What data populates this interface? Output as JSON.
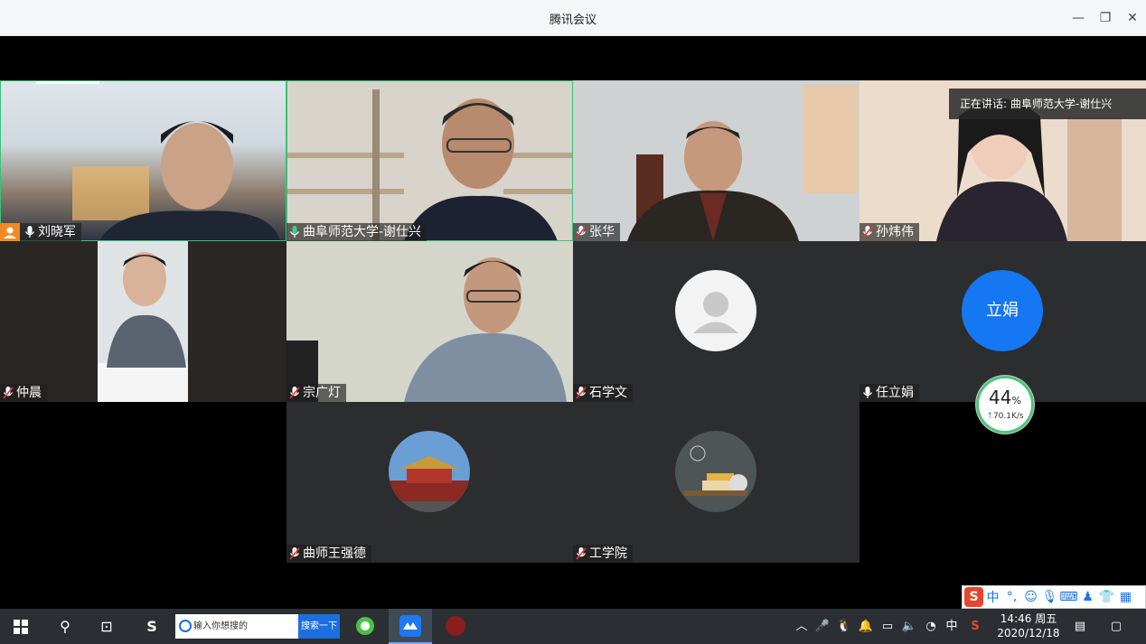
{
  "window": {
    "title": "腾讯会议"
  },
  "speaking": {
    "label": "正在讲话: 曲阜师范大学-谢仕兴"
  },
  "participants": [
    {
      "name": "刘晓军"
    },
    {
      "name": "曲阜师范大学-谢仕兴"
    },
    {
      "name": "张华"
    },
    {
      "name": "孙炜伟"
    },
    {
      "name": "仲晨"
    },
    {
      "name": "宗广灯"
    },
    {
      "name": "石学文"
    },
    {
      "name": "任立娟",
      "avatar_text": "立娟"
    },
    {
      "name": "曲师王强德"
    },
    {
      "name": "工学院"
    }
  ],
  "network": {
    "percent": "44",
    "unit": "%",
    "speed": "70.1K/s"
  },
  "ime": {
    "mode": "中"
  },
  "taskbar": {
    "search_placeholder": "输入你想搜的",
    "search_button": "搜索一下",
    "ime_indicator": "中",
    "time": "14:46 周五",
    "date": "2020/12/18"
  },
  "colors": {
    "accent_blue": "#1677f2",
    "active_green": "#39c27a",
    "host_orange": "#f08a24"
  }
}
